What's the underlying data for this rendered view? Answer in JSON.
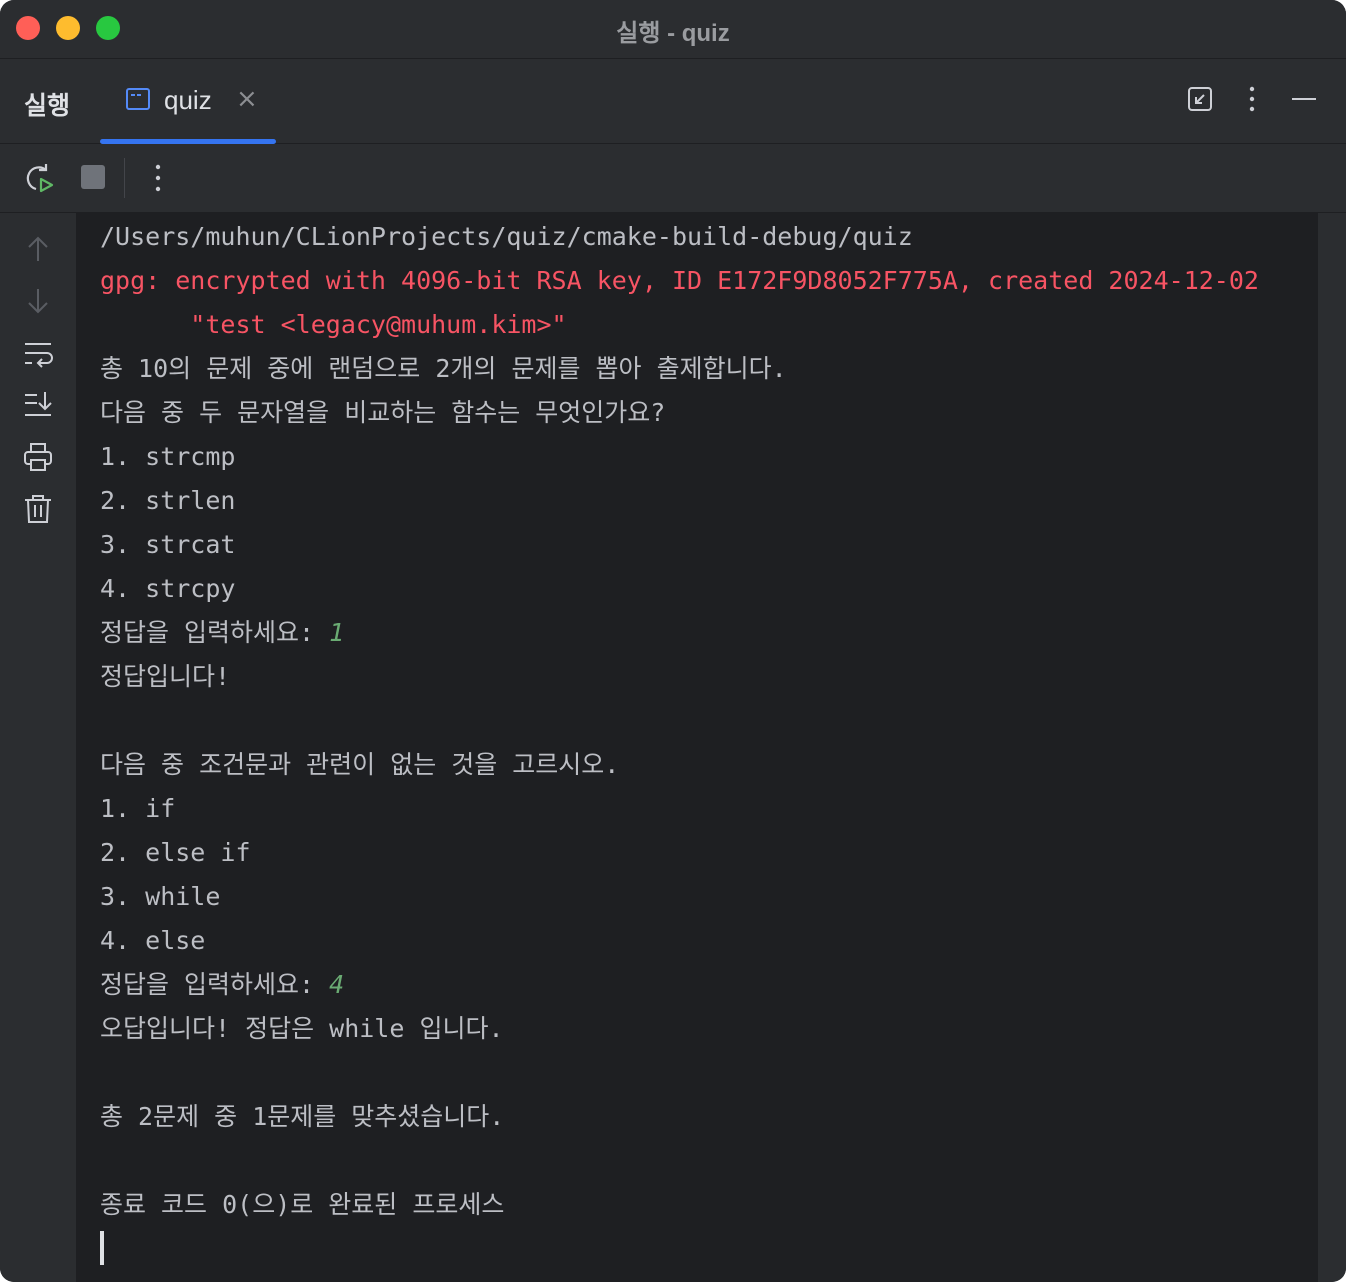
{
  "window": {
    "title": "실행 - quiz"
  },
  "panel": {
    "title": "실행",
    "tab_label": "quiz"
  },
  "icons": {
    "close_tab": "close-icon",
    "restore": "restore-layout-icon",
    "more": "more-vertical-icon",
    "minimize": "minimize-icon",
    "rerun": "rerun-icon",
    "stop": "stop-icon",
    "up": "arrow-up-icon",
    "down": "arrow-down-icon",
    "wrap": "soft-wrap-icon",
    "scroll_end": "scroll-to-end-icon",
    "print": "print-icon",
    "clear": "trash-icon"
  },
  "colors": {
    "accent": "#3574f0",
    "error_text": "#f75464",
    "input_text": "#6aab73",
    "console_bg": "#1e1f22"
  },
  "console": {
    "path": "/Users/muhun/CLionProjects/quiz/cmake-build-debug/quiz",
    "gpg_line1": "gpg: encrypted with 4096-bit RSA key, ID E172F9D8052F775A, created 2024-12-02",
    "gpg_line2": "      \"test <legacy@muhum.kim>\"",
    "intro": "총 10의 문제 중에 랜덤으로 2개의 문제를 뽑아 출제합니다.",
    "q1": {
      "question": "다음 중 두 문자열을 비교하는 함수는 무엇인가요?",
      "options": [
        "1. strcmp",
        "2. strlen",
        "3. strcat",
        "4. strcpy"
      ],
      "prompt": "정답을 입력하세요: ",
      "answer": "1",
      "result": "정답입니다!"
    },
    "q2": {
      "question": "다음 중 조건문과 관련이 없는 것을 고르시오.",
      "options": [
        "1. if",
        "2. else if",
        "3. while",
        "4. else"
      ],
      "prompt": "정답을 입력하세요: ",
      "answer": "4",
      "result": "오답입니다! 정답은 while 입니다."
    },
    "summary": "총 2문제 중 1문제를 맞추셨습니다.",
    "exit": "종료 코드 0(으)로 완료된 프로세스"
  }
}
